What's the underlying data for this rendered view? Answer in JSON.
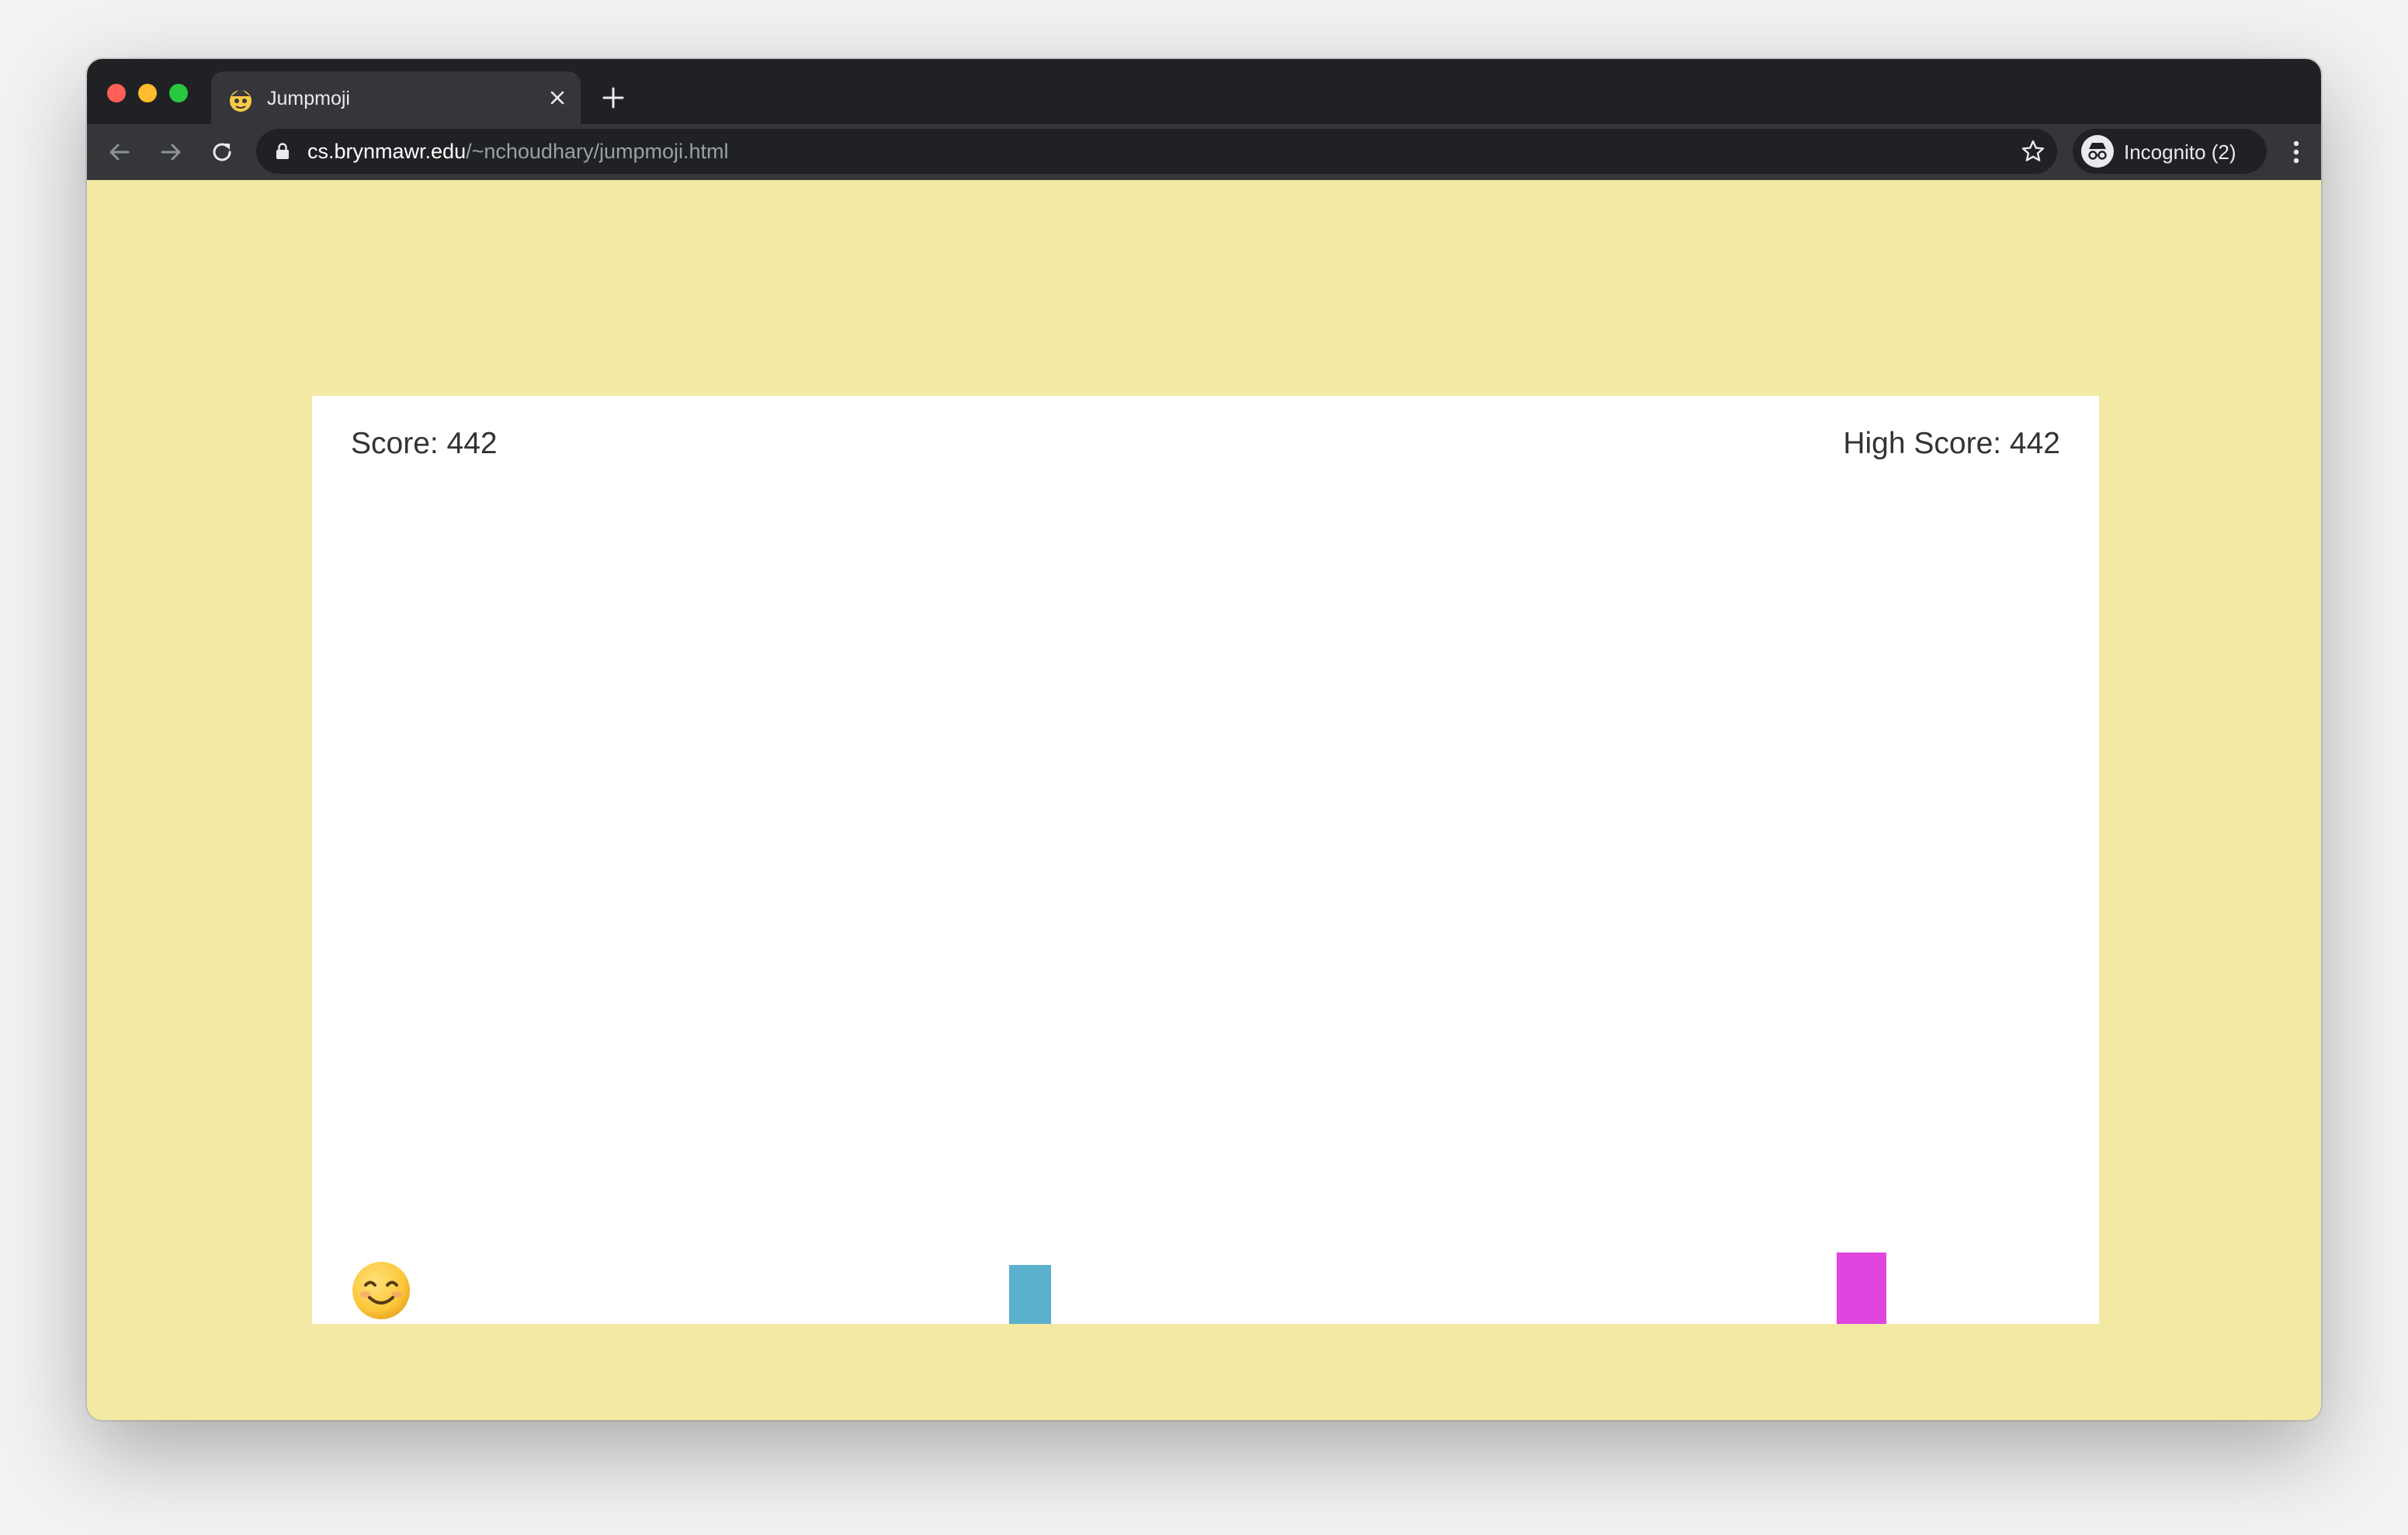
{
  "browser": {
    "tab_title": "Jumpmoji",
    "url_host": "cs.brynmawr.edu",
    "url_path": "/~nchoudhary/jumpmoji.html",
    "profile_label": "Incognito (2)",
    "icons": {
      "traffic_lights": [
        "close-light",
        "minimize-light",
        "maximize-light"
      ],
      "tab": [
        "favicon-icon",
        "tab-close-icon"
      ],
      "toolbar": [
        "back-arrow-icon",
        "forward-arrow-icon",
        "reload-icon",
        "lock-icon",
        "star-icon",
        "incognito-icon",
        "more-menu-icon"
      ],
      "new_tab": "plus-icon"
    },
    "colors": {
      "traffic_close": "#ff5f57",
      "traffic_min": "#febc2e",
      "traffic_max": "#28c840",
      "frame": "#202124",
      "toolbar": "#35363a"
    }
  },
  "game": {
    "score_text": "Score: 442",
    "high_score_text": "High Score: 442",
    "player_emoji": "smiling-face-with-smiling-eyes",
    "obstacles": [
      {
        "color": "#5ab0cd"
      },
      {
        "color": "#e145e0"
      }
    ],
    "colors": {
      "page_background": "#f4e9a3",
      "canvas_background": "#ffffff",
      "score_text": "#333333"
    }
  }
}
